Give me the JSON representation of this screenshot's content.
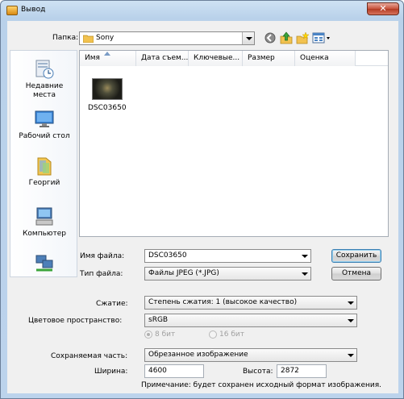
{
  "window": {
    "title": "Вывод",
    "close_label": "✕"
  },
  "toolbar": {
    "folder_label": "Папка:",
    "folder_value": "Sony",
    "back_icon": "back-icon",
    "up_icon": "up-folder-icon",
    "new_folder_icon": "new-folder-icon",
    "view_icon": "view-menu-icon"
  },
  "places": [
    {
      "label": "Недавние места",
      "icon": "recent-places-icon"
    },
    {
      "label": "Рабочий стол",
      "icon": "desktop-icon"
    },
    {
      "label": "Георгий",
      "icon": "user-folder-icon"
    },
    {
      "label": "Компьютер",
      "icon": "computer-icon"
    },
    {
      "label": "",
      "icon": "network-icon"
    }
  ],
  "columns": [
    "Имя",
    "Дата съем...",
    "Ключевые...",
    "Размер",
    "Оценка"
  ],
  "files": [
    {
      "name": "DSC03650"
    }
  ],
  "form": {
    "filename_label": "Имя файла:",
    "filename_value": "DSC03650",
    "filetype_label": "Тип файла:",
    "filetype_value": "Файлы JPEG (*.JPG)",
    "save_button": "Сохранить",
    "cancel_button": "Отмена"
  },
  "options": {
    "compression_label": "Сжатие:",
    "compression_value": "Степень сжатия: 1 (высокое качество)",
    "colorspace_label": "Цветовое пространство:",
    "colorspace_value": "sRGB",
    "bit8_label": "8 бит",
    "bit16_label": "16 бит",
    "part_label": "Сохраняемая часть:",
    "part_value": "Обрезанное изображение",
    "width_label": "Ширина:",
    "width_value": "4600",
    "height_label": "Высота:",
    "height_value": "2872",
    "note": "Примечание: будет сохранен исходный формат изображения."
  },
  "colors": {
    "title_bg": "#b9d1ea",
    "close_red": "#c7523b",
    "client_bg": "#f0f0f0"
  }
}
